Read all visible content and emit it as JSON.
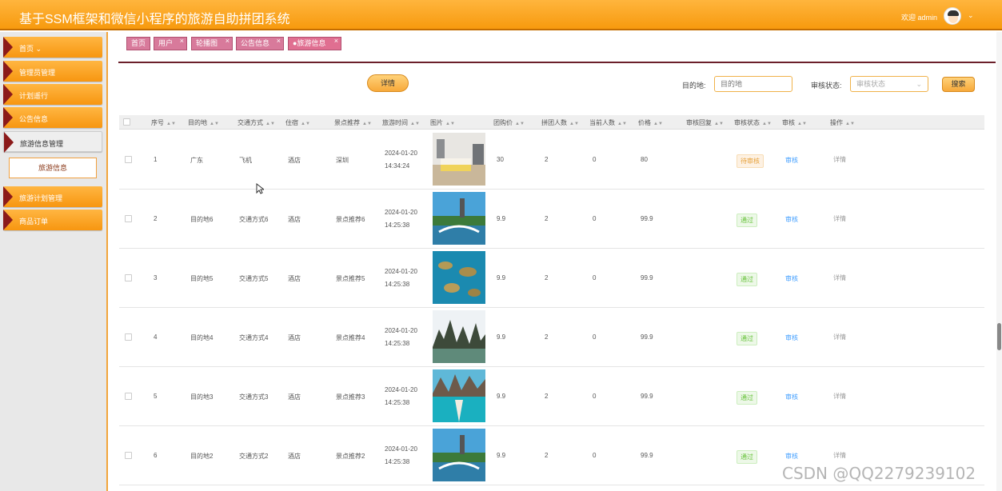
{
  "app": {
    "title": "基于SSM框架和微信小程序的旅游自助拼团系统",
    "welcome": "欢迎 admin",
    "caret": "⌄"
  },
  "sidebar": {
    "items": [
      {
        "label": "首页 ⌄"
      },
      {
        "label": "管理员管理"
      },
      {
        "label": "计划遥行"
      },
      {
        "label": "公告信息"
      },
      {
        "label": "旅游信息管理"
      },
      {
        "label": "旅游计划管理"
      },
      {
        "label": "商品订单"
      }
    ],
    "sub_item": "旅游信息"
  },
  "tabs": [
    {
      "label": "首页"
    },
    {
      "label": "用户"
    },
    {
      "label": "轮播图"
    },
    {
      "label": "公告信息"
    },
    {
      "label": "●旅游信息"
    }
  ],
  "tab_close": "×",
  "toolbar": {
    "detail_btn": "详情",
    "dest_label": "目的地:",
    "dest_placeholder": "目的地",
    "status_label": "审核状态:",
    "status_placeholder": "审核状态",
    "search_btn": "搜索"
  },
  "columns": [
    "序号",
    "目的地",
    "交通方式",
    "住宿",
    "景点推荐",
    "旅游时间",
    "图片",
    "团购价",
    "拼团人数",
    "当前人数",
    "价格",
    "审核回复",
    "审核状态",
    "审核",
    "操作"
  ],
  "rows": [
    {
      "no": "1",
      "dest": "广东",
      "transport": "飞机",
      "stay": "酒店",
      "spot": "深圳",
      "date": "2024-01-20",
      "time": "14:34:24",
      "group_price": "30",
      "group_size": "2",
      "current": "0",
      "price": "80",
      "status": "待审核",
      "audit": "审核",
      "op": "详情"
    },
    {
      "no": "2",
      "dest": "目的地6",
      "transport": "交通方式6",
      "stay": "酒店",
      "spot": "景点推荐6",
      "date": "2024-01-20",
      "time": "14:25:38",
      "group_price": "9.9",
      "group_size": "2",
      "current": "0",
      "price": "99.9",
      "status": "通过",
      "audit": "审核",
      "op": "详情"
    },
    {
      "no": "3",
      "dest": "目的地5",
      "transport": "交通方式5",
      "stay": "酒店",
      "spot": "景点推荐5",
      "date": "2024-01-20",
      "time": "14:25:38",
      "group_price": "9.9",
      "group_size": "2",
      "current": "0",
      "price": "99.9",
      "status": "通过",
      "audit": "审核",
      "op": "详情"
    },
    {
      "no": "4",
      "dest": "目的地4",
      "transport": "交通方式4",
      "stay": "酒店",
      "spot": "景点推荐4",
      "date": "2024-01-20",
      "time": "14:25:38",
      "group_price": "9.9",
      "group_size": "2",
      "current": "0",
      "price": "99.9",
      "status": "通过",
      "audit": "审核",
      "op": "详情"
    },
    {
      "no": "5",
      "dest": "目的地3",
      "transport": "交通方式3",
      "stay": "酒店",
      "spot": "景点推荐3",
      "date": "2024-01-20",
      "time": "14:25:38",
      "group_price": "9.9",
      "group_size": "2",
      "current": "0",
      "price": "99.9",
      "status": "通过",
      "audit": "审核",
      "op": "详情"
    },
    {
      "no": "6",
      "dest": "目的地2",
      "transport": "交通方式2",
      "stay": "酒店",
      "spot": "景点推荐2",
      "date": "2024-01-20",
      "time": "14:25:38",
      "group_price": "9.9",
      "group_size": "2",
      "current": "0",
      "price": "99.9",
      "status": "通过",
      "audit": "审核",
      "op": "详情"
    }
  ],
  "watermark": "CSDN @QQ2279239102",
  "colors": {
    "header": "#f79a0e",
    "tab": "#d87a9b",
    "accent_dark": "#8b1a1a",
    "link": "#409eff",
    "pass": "#67c23a",
    "pending": "#e6a23c"
  }
}
